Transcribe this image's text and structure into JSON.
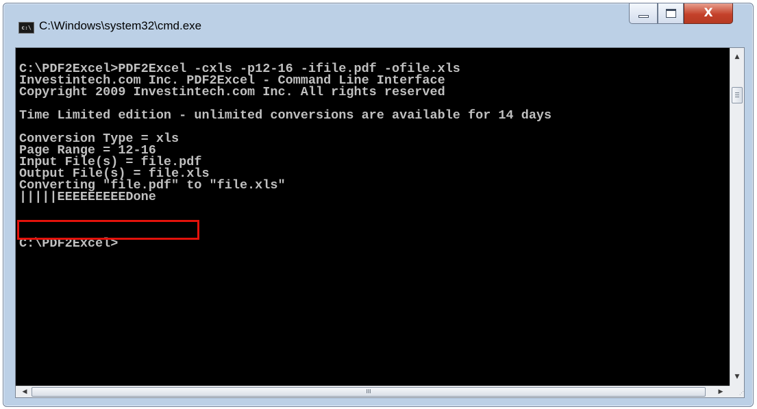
{
  "window": {
    "title": "C:\\Windows\\system32\\cmd.exe",
    "icon": "cmd-app-icon",
    "icon_text": "c:\\",
    "controls": {
      "minimize_icon": "minimize-icon",
      "maximize_icon": "maximize-icon",
      "close_icon": "close-icon",
      "close_glyph": "X"
    }
  },
  "console": {
    "lines": [
      "C:\\PDF2Excel>PDF2Excel -cxls -p12-16 -ifile.pdf -ofile.xls",
      "Investintech.com Inc. PDF2Excel - Command Line Interface",
      "Copyright 2009 Investintech.com Inc. All rights reserved",
      "",
      "Time Limited edition - unlimited conversions are available for 14 days",
      "",
      "Conversion Type = xls",
      "Page Range = 12-16",
      "Input File(s) = file.pdf",
      "Output File(s) = file.xls",
      "Converting \"file.pdf\" to \"file.xls\"",
      "|||||EEEEEEEEEDone",
      "",
      "",
      "",
      "C:\\PDF2Excel>"
    ],
    "text_color": "#c0c0c0",
    "background_color": "#000000",
    "highlight_color": "#e3120b"
  },
  "scrollbars": {
    "up_arrow": "▲",
    "down_arrow": "▼",
    "left_arrow": "◀",
    "right_arrow": "▶",
    "h_thumb_grip": "III"
  }
}
